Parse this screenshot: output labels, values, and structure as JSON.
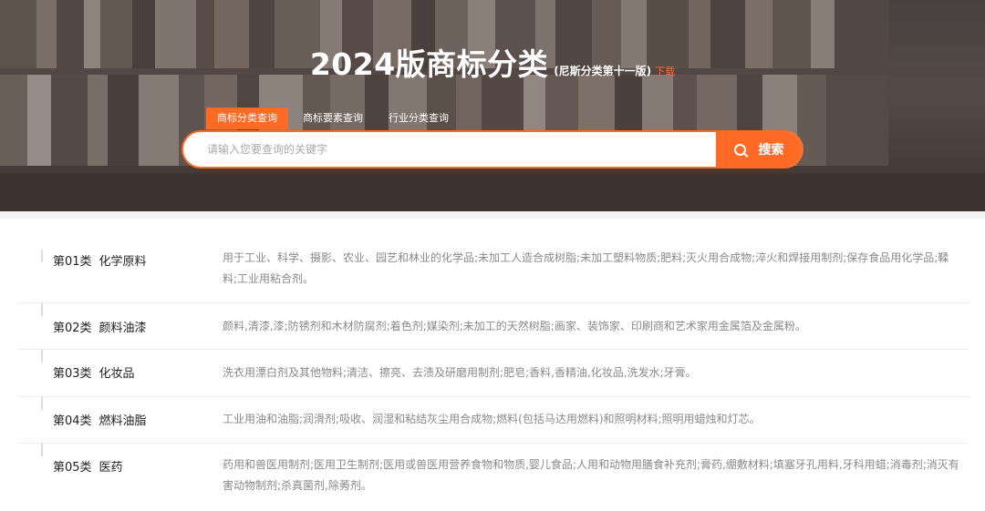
{
  "header": {
    "title": "2024版商标分类",
    "subtitle": "(尼斯分类第十一版)",
    "download_label": "下载"
  },
  "tabs": [
    {
      "label": "商标分类查询",
      "active": true
    },
    {
      "label": "商标要素查询",
      "active": false
    },
    {
      "label": "行业分类查询",
      "active": false
    }
  ],
  "search": {
    "value": "",
    "placeholder": "请输入您要查询的关键字",
    "button_label": "搜索",
    "icon": "search-icon"
  },
  "classes": [
    {
      "code": "第01类",
      "name": "化学原料",
      "desc": "用于工业、科学、摄影、农业、园艺和林业的化学品;未加工人造合成树脂;未加工塑料物质;肥料;灭火用合成物;淬火和焊接用制剂;保存食品用化学品;鞣料;工业用粘合剂。"
    },
    {
      "code": "第02类",
      "name": "颜料油漆",
      "desc": "颜料,清漆,漆;防锈剂和木材防腐剂;着色剂;媒染剂;未加工的天然树脂;画家、装饰家、印刷商和艺术家用金属箔及金属粉。"
    },
    {
      "code": "第03类",
      "name": "化妆品",
      "desc": "洗衣用漂白剂及其他物料;清洁、擦亮、去渍及研磨用制剂;肥皂;香料,香精油,化妆品,洗发水;牙膏。"
    },
    {
      "code": "第04类",
      "name": "燃料油脂",
      "desc": "工业用油和油脂;润滑剂;吸收、润湿和粘结灰尘用合成物;燃料(包括马达用燃料)和照明材料;照明用蜡烛和灯芯。"
    },
    {
      "code": "第05类",
      "name": "医药",
      "desc": "药用和兽医用制剂;医用卫生制剂;医用或兽医用营养食物和物质,婴儿食品;人用和动物用膳食补充剂;膏药,绷敷材料;填塞牙孔用料,牙科用蜡;消毒剂;消灭有害动物制剂;杀真菌剂,除莠剂。"
    }
  ],
  "colors": {
    "accent": "#ff6a25"
  }
}
